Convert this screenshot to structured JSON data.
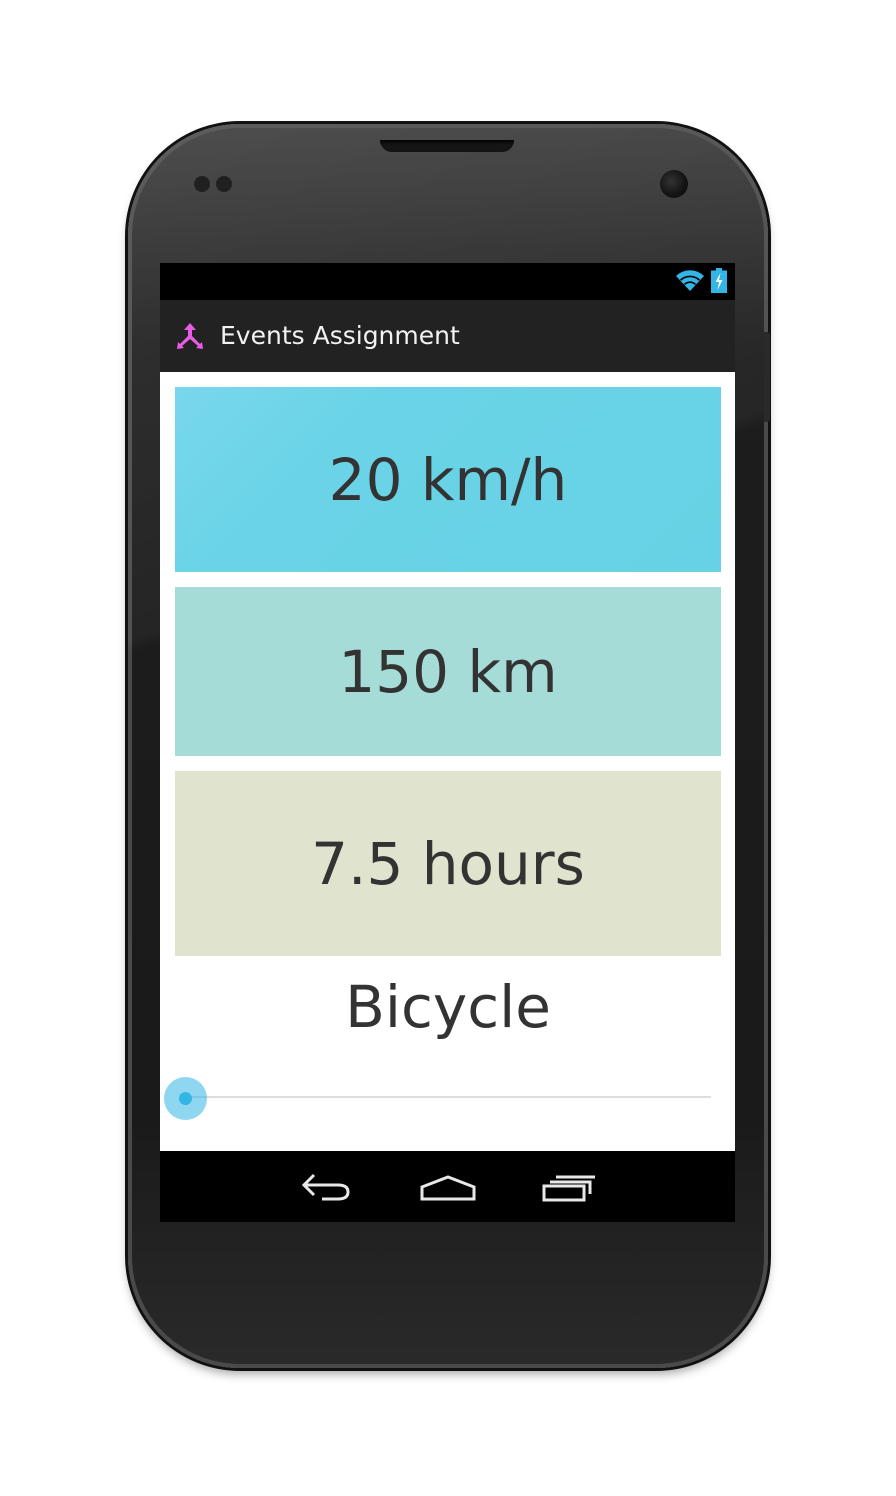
{
  "app": {
    "title": "Events Assignment",
    "icon": "merge-arrows-icon"
  },
  "status_bar": {
    "icons": [
      "wifi-icon",
      "battery-charging-icon"
    ]
  },
  "tiles": {
    "speed": "20 km/h",
    "distance": "150 km",
    "time": "7.5 hours"
  },
  "vehicle": {
    "label": "Bicycle"
  },
  "seekbar": {
    "progress": 0
  },
  "nav_bar": {
    "buttons": [
      "back-icon",
      "home-icon",
      "recent-apps-icon"
    ]
  },
  "colors": {
    "speed_tile": "#6ad3e7",
    "distance_tile": "#a6dcd8",
    "time_tile": "#e0e3cd",
    "accent": "#33b5e5",
    "app_icon": "#e85ce6"
  }
}
